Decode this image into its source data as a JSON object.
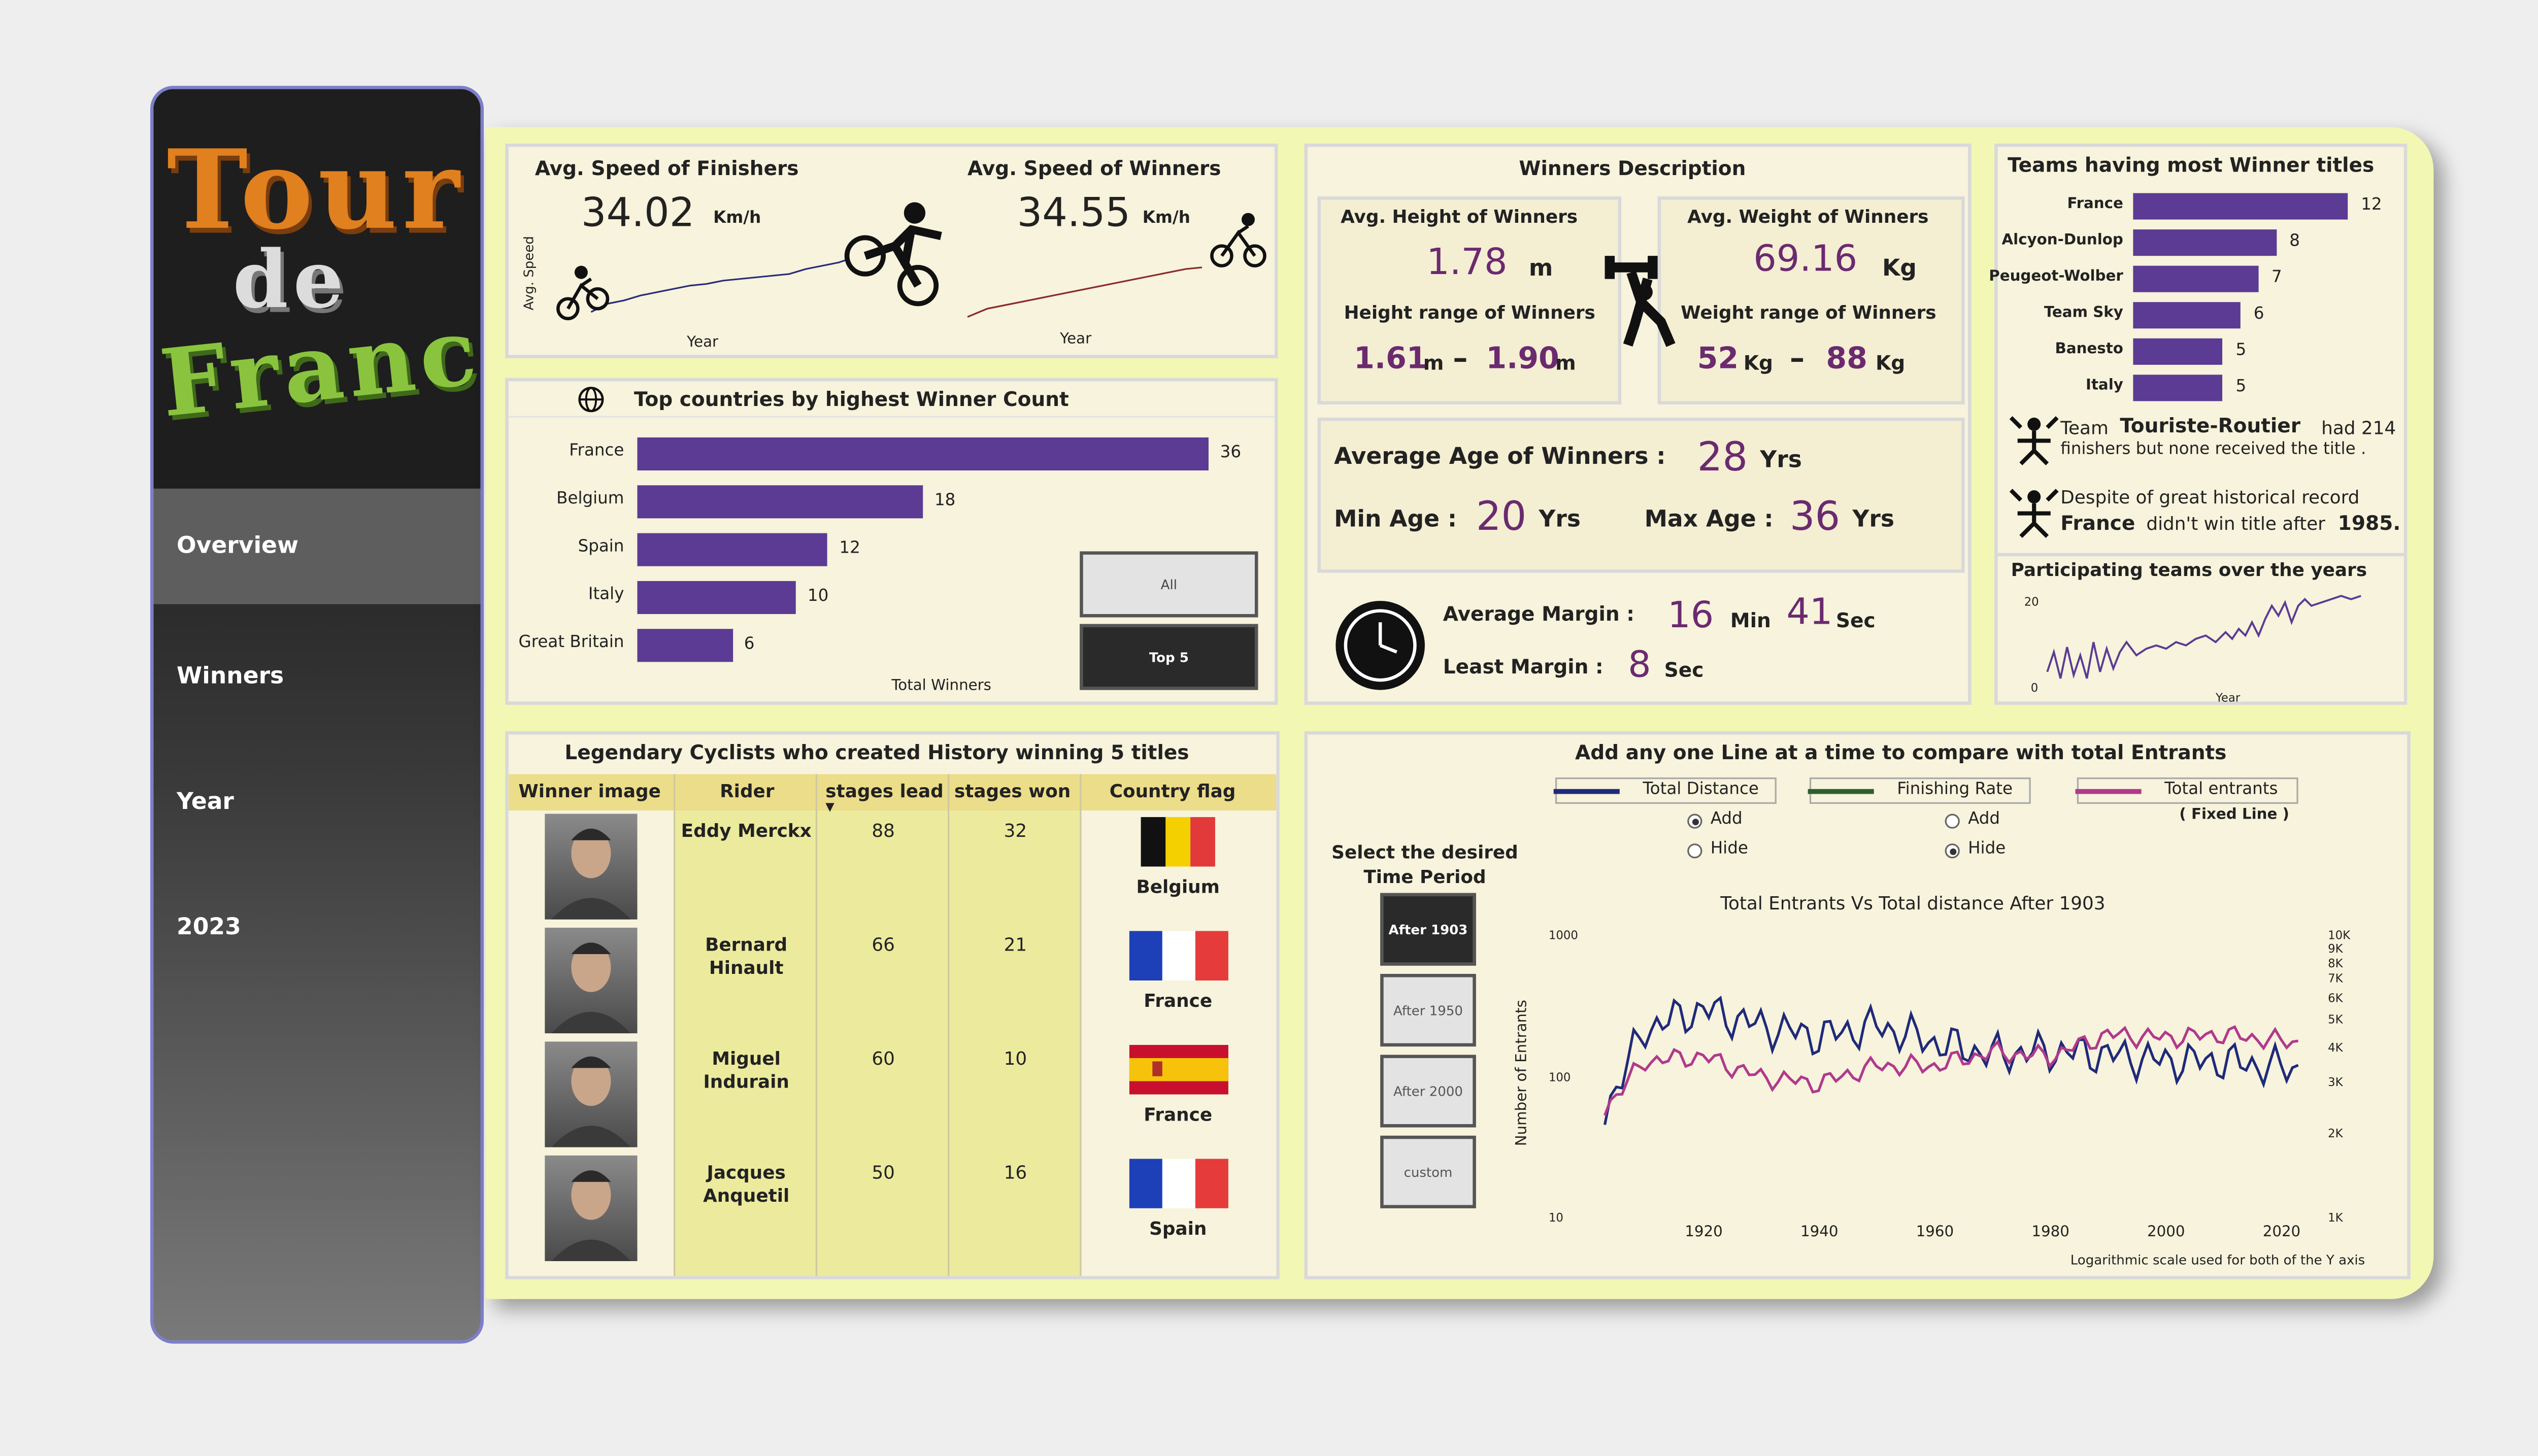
{
  "sidebar": {
    "logo_lines": [
      "Tour",
      "de",
      "France"
    ],
    "nav": [
      "Overview",
      "Winners",
      "Year",
      "2023"
    ],
    "active": "Overview"
  },
  "speed": {
    "finishers_title": "Avg. Speed of Finishers",
    "finishers_value": "34.02",
    "winners_title": "Avg. Speed of Winners",
    "winners_value": "34.55",
    "unit": "Km/h",
    "y_label": "Avg. Speed",
    "x_label": "Year"
  },
  "countries": {
    "title": "Top countries by highest Winner Count",
    "x_label": "Total Winners",
    "items": [
      {
        "label": "France",
        "value": 36
      },
      {
        "label": "Belgium",
        "value": 18
      },
      {
        "label": "Spain",
        "value": 12
      },
      {
        "label": "Italy",
        "value": 10
      },
      {
        "label": "Great Britain",
        "value": 6
      }
    ],
    "buttons": [
      "All",
      "Top 5"
    ],
    "selected": "Top 5"
  },
  "winners_desc": {
    "title": "Winners Description",
    "height_title": "Avg. Height of Winners",
    "height_value": "1.78",
    "height_unit": "m",
    "height_range_title": "Height range of Winners",
    "height_min": "1.61",
    "height_max": "1.90",
    "height_range_unit": "m",
    "weight_title": "Avg. Weight of Winners",
    "weight_value": "69.16",
    "weight_unit": "Kg",
    "weight_range_title": "Weight range of Winners",
    "weight_min": "52",
    "weight_max": "88",
    "weight_range_unit": "Kg",
    "dash": "–",
    "avg_age_label": "Average Age of Winners :",
    "avg_age": "28",
    "min_age_label": "Min Age :",
    "min_age": "20",
    "max_age_label": "Max Age :",
    "max_age": "36",
    "yrs": "Yrs",
    "avg_margin_label": "Average Margin :",
    "avg_margin_min": "16",
    "min_unit": "Min",
    "avg_margin_sec": "41",
    "sec_unit": "Sec",
    "least_margin_label": "Least Margin :",
    "least_margin_sec": "8"
  },
  "teams": {
    "title": "Teams having most Winner titles",
    "items": [
      {
        "label": "France",
        "value": 12
      },
      {
        "label": "Alcyon-Dunlop",
        "value": 8
      },
      {
        "label": "Peugeot-Wolber",
        "value": 7
      },
      {
        "label": "Team Sky",
        "value": 6
      },
      {
        "label": "Banesto",
        "value": 5
      },
      {
        "label": "Italy",
        "value": 5
      }
    ],
    "note1_a": "Team",
    "note1_b": "Touriste-Routier",
    "note1_c": "had 214",
    "note1_d": "finishers but none received the title .",
    "note2_a": "Despite of great historical record",
    "note2_b": "France",
    "note2_c": "didn't win title after",
    "note2_d": "1985.",
    "participating_title": "Participating teams over the years",
    "y_ticks": [
      "20",
      "0"
    ],
    "x_label": "Year"
  },
  "legends": {
    "title": "Legendary Cyclists who created History winning 5 titles",
    "columns": [
      "Winner image",
      "Rider",
      "stages lead",
      "stages won",
      "Country flag"
    ],
    "sort_marker": "▼",
    "rows": [
      {
        "rider": "Eddy Merckx",
        "lead": "88",
        "won": "32",
        "country": "Belgium",
        "flag": "belgium"
      },
      {
        "rider": "Bernard Hinault",
        "lead": "66",
        "won": "21",
        "country": "France",
        "flag": "france"
      },
      {
        "rider": "Miguel Indurain",
        "lead": "60",
        "won": "10",
        "country": "France",
        "flag": "spain"
      },
      {
        "rider": "Jacques Anquetil",
        "lead": "50",
        "won": "16",
        "country": "Spain",
        "flag": "france"
      }
    ]
  },
  "compare": {
    "title": "Add any one Line at a time to compare with total Entrants",
    "legend": [
      {
        "label": "Total Distance",
        "color": "#1f2a7a"
      },
      {
        "label": "Finishing Rate",
        "color": "#2e5e2e"
      },
      {
        "label": "Total entrants",
        "color": "#b03a8c"
      }
    ],
    "fixed_line": "( Fixed Line )",
    "add": "Add",
    "hide": "Hide",
    "period_label": "Select the desired Time Period",
    "periods": [
      "After 1903",
      "After 1950",
      "After 2000",
      "custom"
    ],
    "selected_period": "After 1903",
    "chart_title": "Total Entrants Vs Total distance After 1903",
    "y_label": "Number of Entrants",
    "left_ticks": [
      "1000",
      "100",
      "10"
    ],
    "right_ticks": [
      "10K",
      "9K",
      "8K",
      "7K",
      "6K",
      "5K",
      "4K",
      "3K",
      "2K",
      "1K"
    ],
    "x_ticks": [
      "1920",
      "1940",
      "1960",
      "1980",
      "2000",
      "2020"
    ],
    "footnote": "Logarithmic scale used for both of the Y axis"
  },
  "chart_data": [
    {
      "type": "bar",
      "title": "Top countries by highest Winner Count",
      "xlabel": "Total Winners",
      "categories": [
        "France",
        "Belgium",
        "Spain",
        "Italy",
        "Great Britain"
      ],
      "values": [
        36,
        18,
        12,
        10,
        6
      ]
    },
    {
      "type": "bar",
      "title": "Teams having most Winner titles",
      "categories": [
        "France",
        "Alcyon-Dunlop",
        "Peugeot-Wolber",
        "Team Sky",
        "Banesto",
        "Italy"
      ],
      "values": [
        12,
        8,
        7,
        6,
        5,
        5
      ]
    },
    {
      "type": "line",
      "title": "Total Entrants Vs Total distance After 1903",
      "ylabel": "Number of Entrants",
      "log_scale": true,
      "x": [
        1903,
        1910,
        1920,
        1930,
        1940,
        1950,
        1960,
        1970,
        1980,
        1990,
        2000,
        2010,
        2020,
        2023
      ],
      "series": [
        {
          "name": "Total Distance",
          "values": [
            2400,
            4700,
            5500,
            4800,
            4400,
            4800,
            4200,
            3800,
            3900,
            3800,
            3600,
            3600,
            3400,
            3400
          ]
        },
        {
          "name": "Total entrants",
          "values": [
            60,
            130,
            140,
            100,
            90,
            120,
            120,
            150,
            140,
            200,
            190,
            200,
            180,
            176
          ]
        }
      ]
    }
  ]
}
